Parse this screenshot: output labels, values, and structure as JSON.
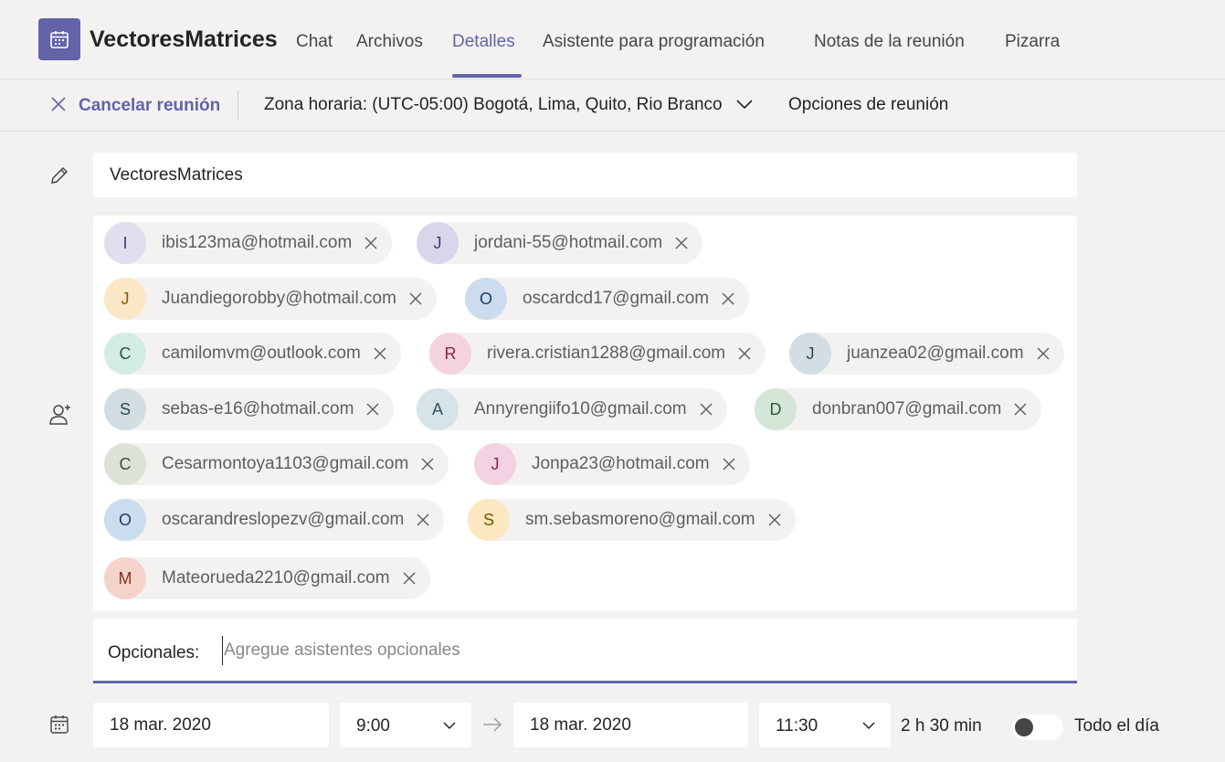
{
  "header": {
    "title": "VectoresMatrices",
    "tabs": [
      {
        "label": "Chat"
      },
      {
        "label": "Archivos"
      },
      {
        "label": "Detalles"
      },
      {
        "label": "Asistente para programación"
      },
      {
        "label": "Notas de la reunión"
      },
      {
        "label": "Pizarra"
      }
    ],
    "active_tab": "Detalles"
  },
  "toolbar": {
    "cancel_label": "Cancelar reunión",
    "timezone_label": "Zona horaria: (UTC-05:00) Bogotá, Lima, Quito, Rio Branco",
    "meeting_options_label": "Opciones de reunión"
  },
  "form": {
    "title_value": "VectoresMatrices",
    "attendees": [
      {
        "initial": "I",
        "email": "ibis123ma@hotmail.com",
        "bg": "#e1dfef",
        "fg": "#3f3b6b"
      },
      {
        "initial": "J",
        "email": "jordani-55@hotmail.com",
        "bg": "#d9d6ec",
        "fg": "#3f3b6b"
      },
      {
        "initial": "J",
        "email": "Juandiegorobby@hotmail.com",
        "bg": "#fbe7c6",
        "fg": "#8a5a00"
      },
      {
        "initial": "O",
        "email": "oscardcd17@gmail.com",
        "bg": "#ccdcee",
        "fg": "#1d3f63"
      },
      {
        "initial": "C",
        "email": "camilomvm@outlook.com",
        "bg": "#d3ede3",
        "fg": "#24593f"
      },
      {
        "initial": "R",
        "email": "rivera.cristian1288@gmail.com",
        "bg": "#f4d3df",
        "fg": "#8e2148"
      },
      {
        "initial": "J",
        "email": "juanzea02@gmail.com",
        "bg": "#d3dde4",
        "fg": "#2d4556"
      },
      {
        "initial": "S",
        "email": "sebas-e16@hotmail.com",
        "bg": "#d2dde2",
        "fg": "#2b4753"
      },
      {
        "initial": "A",
        "email": "Annyrengiifo10@gmail.com",
        "bg": "#d6e3e8",
        "fg": "#2f5260"
      },
      {
        "initial": "D",
        "email": "donbran007@gmail.com",
        "bg": "#d3e6d8",
        "fg": "#2c5a3a"
      },
      {
        "initial": "C",
        "email": "Cesarmontoya1103@gmail.com",
        "bg": "#dbe2d6",
        "fg": "#3f5034"
      },
      {
        "initial": "J",
        "email": "Jonpa23@hotmail.com",
        "bg": "#f3d2e2",
        "fg": "#8a2456"
      },
      {
        "initial": "O",
        "email": "oscarandreslopezv@gmail.com",
        "bg": "#ccdcef",
        "fg": "#1d3f63"
      },
      {
        "initial": "S",
        "email": "sm.sebasmoreno@gmail.com",
        "bg": "#fbe8c0",
        "fg": "#7a5200"
      },
      {
        "initial": "M",
        "email": "Mateorueda2210@gmail.com",
        "bg": "#f4d3cb",
        "fg": "#8a2e1c"
      }
    ],
    "optional_label": "Opcionales:",
    "optional_placeholder": "Agregue asistentes opcionales",
    "start_date": "18 mar. 2020",
    "start_time": "9:00",
    "end_date": "18 mar. 2020",
    "end_time": "11:30",
    "duration": "2 h 30 min",
    "all_day_label": "Todo el día",
    "all_day_on": false
  },
  "colors": {
    "accent": "#6264a7",
    "background": "#f3f2f1",
    "surface": "#ffffff",
    "text": "#252423"
  },
  "icons": [
    "calendar-icon",
    "close-icon",
    "chevron-down-icon",
    "pencil-icon",
    "add-person-icon",
    "arrow-right-icon"
  ]
}
